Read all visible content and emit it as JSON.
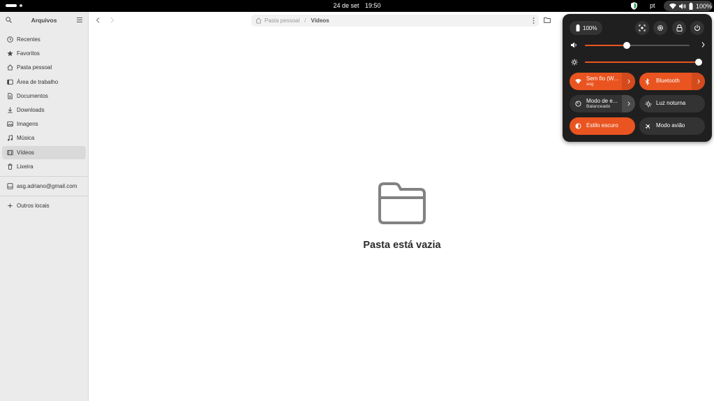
{
  "topbar": {
    "date": "24 de set",
    "time": "19:50",
    "language": "pt",
    "battery": "100%"
  },
  "sidebar": {
    "title": "Arquivos",
    "items": [
      {
        "label": "Recentes",
        "icon": "clock-icon"
      },
      {
        "label": "Favoritos",
        "icon": "star-icon"
      },
      {
        "label": "Pasta pessoal",
        "icon": "home-icon"
      },
      {
        "label": "Área de trabalho",
        "icon": "desktop-icon"
      },
      {
        "label": "Documentos",
        "icon": "document-icon"
      },
      {
        "label": "Downloads",
        "icon": "download-icon"
      },
      {
        "label": "Imagens",
        "icon": "image-icon"
      },
      {
        "label": "Música",
        "icon": "music-icon"
      },
      {
        "label": "Vídeos",
        "icon": "video-icon",
        "active": true
      },
      {
        "label": "Lixeira",
        "icon": "trash-icon"
      }
    ],
    "account": "asg.adriano@gmail.com",
    "other_locations": "Outros locais"
  },
  "pathbar": {
    "parent": "Pasta pessoal",
    "separator": "/",
    "current": "Vídeos"
  },
  "empty_state": {
    "message": "Pasta está vazia"
  },
  "quick_settings": {
    "battery": "100%",
    "volume_level": 0.4,
    "brightness_level": 1.0,
    "tiles": {
      "wifi": {
        "label": "Sem fio (W...",
        "sub": "asg",
        "on": true
      },
      "bluetooth": {
        "label": "Bluetooth",
        "on": true
      },
      "power_mode": {
        "label": "Modo de e...",
        "sub": "Balanceado",
        "on": false
      },
      "night_light": {
        "label": "Luz noturna",
        "on": false
      },
      "dark_style": {
        "label": "Estilo escuro",
        "on": true
      },
      "airplane": {
        "label": "Modo avião",
        "on": false
      }
    },
    "colors": {
      "accent": "#e95420",
      "tile_off": "#333333",
      "panel": "#1f1f1f"
    }
  }
}
